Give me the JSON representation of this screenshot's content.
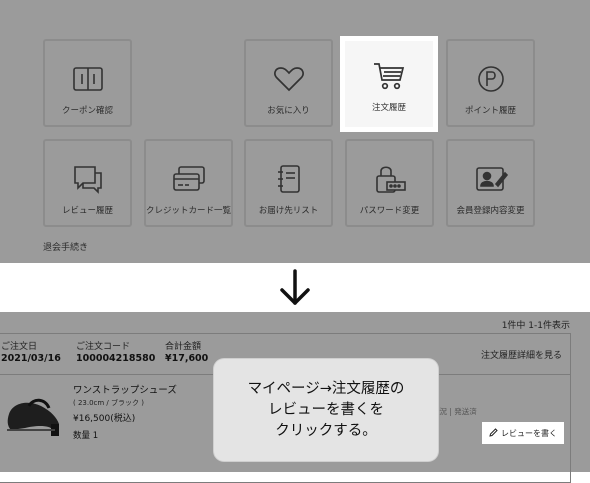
{
  "menu": {
    "tiles": [
      {
        "label": "クーポン確認",
        "icon": "coupon-book-icon"
      },
      {
        "label": "お気に入り",
        "icon": "heart-icon"
      },
      {
        "label": "注文履歴",
        "icon": "cart-icon"
      },
      {
        "label": "ポイント履歴",
        "icon": "point-icon"
      },
      {
        "label": "レビュー履歴",
        "icon": "review-chat-icon"
      },
      {
        "label": "クレジットカード一覧",
        "icon": "credit-card-icon"
      },
      {
        "label": "お届け先リスト",
        "icon": "address-book-icon"
      },
      {
        "label": "パスワード変更",
        "icon": "lock-icon"
      },
      {
        "label": "会員登録内容変更",
        "icon": "member-edit-icon"
      }
    ],
    "withdraw_label": "退会手続き"
  },
  "orders": {
    "count_text": "1件中 1-1件表示",
    "header": {
      "date_label": "ご注文日",
      "date_value": "2021/03/16",
      "code_label": "ご注文コード",
      "code_value": "100004218580",
      "total_label": "合計金額",
      "total_value": "¥17,600",
      "detail_link": "注文履歴詳細を見る"
    },
    "item": {
      "name": "ワンストラップシューズ",
      "variant": "( 23.0cm / ブラック )",
      "price": "¥16,500(税込)",
      "qty": "数量 1",
      "ship_status": "配送状況 | 発送済",
      "review_button": "レビューを書く"
    }
  },
  "callout": {
    "line1": "マイページ→注文履歴の",
    "line2": "レビューを書くを",
    "line3": "クリックする。"
  }
}
